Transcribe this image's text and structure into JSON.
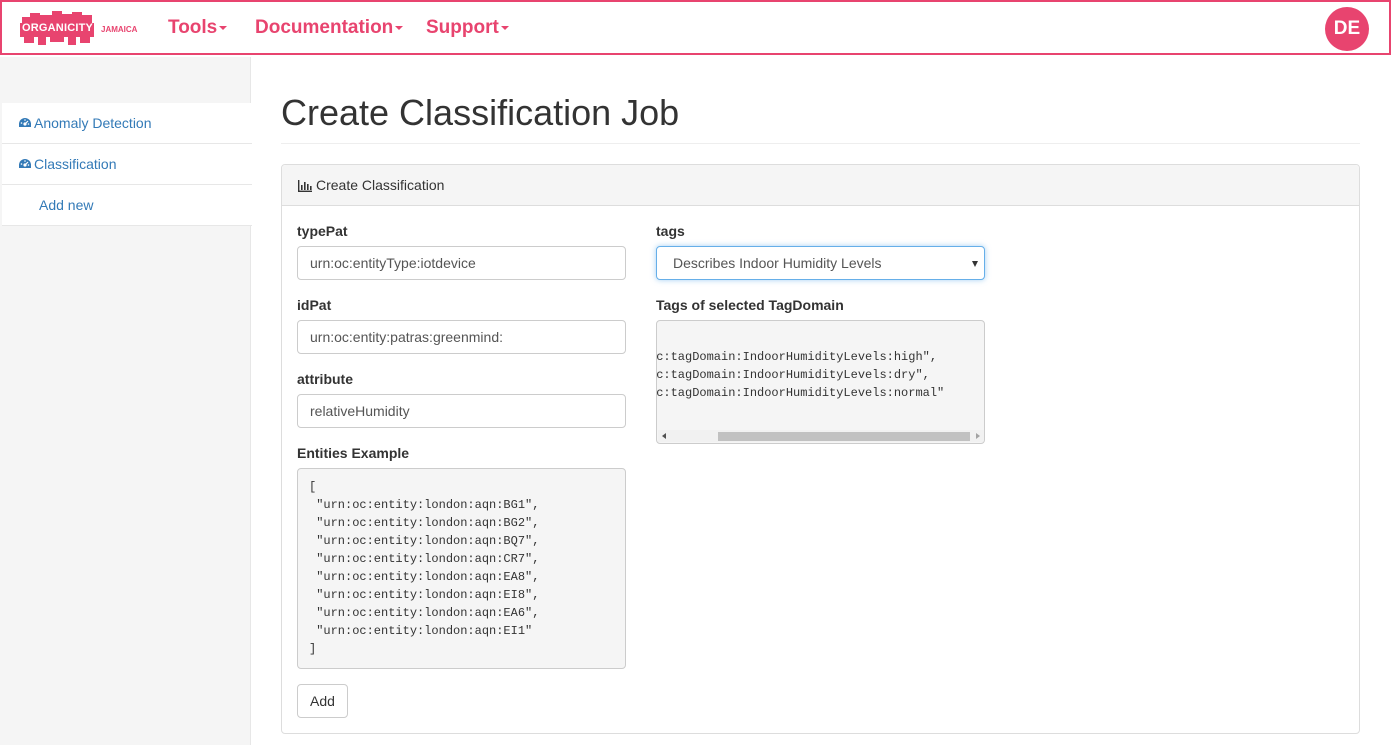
{
  "brand": {
    "logo_text": "ORGANICITY",
    "logo_sub": "JAMAICA",
    "accent": "#e8446f"
  },
  "nav": {
    "items": [
      {
        "label": "Tools"
      },
      {
        "label": "Documentation"
      },
      {
        "label": "Support"
      }
    ],
    "avatar_initials": "DE"
  },
  "sidebar": {
    "items": [
      {
        "label": "Anomaly Detection",
        "icon": "dashboard-icon"
      },
      {
        "label": "Classification",
        "icon": "dashboard-icon"
      },
      {
        "label": "Add new"
      }
    ]
  },
  "main": {
    "title": "Create Classification Job",
    "panel_title": "Create Classification",
    "panel_icon": "bar-chart-icon",
    "form": {
      "typePat": {
        "label": "typePat",
        "value": "urn:oc:entityType:iotdevice"
      },
      "idPat": {
        "label": "idPat",
        "value": "urn:oc:entity:patras:greenmind:"
      },
      "attribute": {
        "label": "attribute",
        "value": "relativeHumidity"
      },
      "entities_example": {
        "label": "Entities Example",
        "text": "[\n \"urn:oc:entity:london:aqn:BG1\",\n \"urn:oc:entity:london:aqn:BG2\",\n \"urn:oc:entity:london:aqn:BQ7\",\n \"urn:oc:entity:london:aqn:CR7\",\n \"urn:oc:entity:london:aqn:EA8\",\n \"urn:oc:entity:london:aqn:EI8\",\n \"urn:oc:entity:london:aqn:EA6\",\n \"urn:oc:entity:london:aqn:EI1\"\n]"
      },
      "tags": {
        "label": "tags",
        "selected": "Describes Indoor Humidity Levels"
      },
      "tag_domain": {
        "label": "Tags of selected TagDomain",
        "text": "oc:tagDomain:IndoorHumidityLevels:high\",\noc:tagDomain:IndoorHumidityLevels:dry\",\noc:tagDomain:IndoorHumidityLevels:normal\""
      },
      "add_button": "Add"
    }
  }
}
